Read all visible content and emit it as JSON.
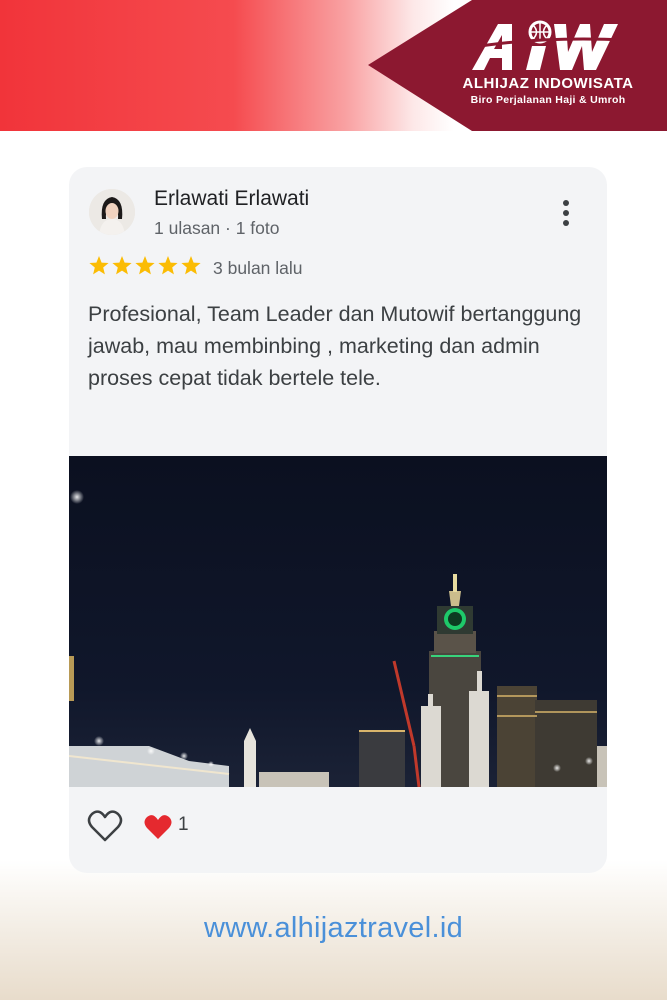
{
  "brand": {
    "logo_letters": "AIW",
    "name": "ALHIJAZ INDOWISATA",
    "tagline": "Biro Perjalanan Haji & Umroh",
    "colors": {
      "banner_red": "#f1343a",
      "badge_maroon": "#8c1830"
    }
  },
  "review": {
    "reviewer_name": "Erlawati Erlawati",
    "reviewer_meta": "1 ulasan · 1 foto",
    "rating": 5,
    "rating_max": 5,
    "age": "3 bulan lalu",
    "text": "Profesional, Team Leader dan Mutowif bertanggung jawab, mau membinbing , marketing dan admin proses cepat tidak bertele tele.",
    "reaction_count": "1",
    "icons": {
      "more": "more-vert-icon",
      "star": "star-icon",
      "like": "heart-outline-icon",
      "reaction": "heart-filled-icon"
    },
    "colors": {
      "star": "#fbbc04",
      "reaction_heart": "#e5292f"
    }
  },
  "footer": {
    "url": "www.alhijaztravel.id"
  }
}
